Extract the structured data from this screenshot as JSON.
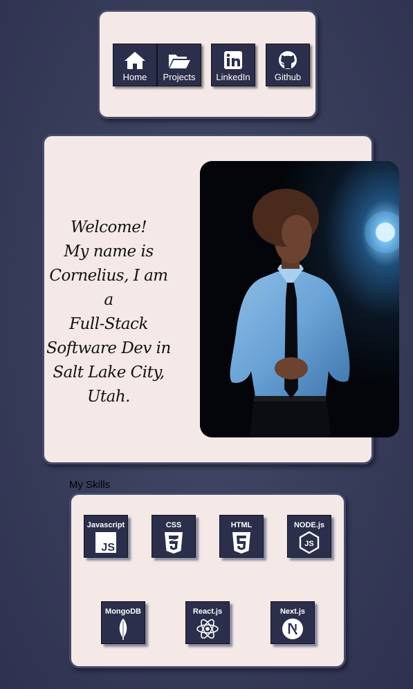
{
  "nav": {
    "items": [
      {
        "label": "Home",
        "icon": "home-icon"
      },
      {
        "label": "Projects",
        "icon": "folder-open-icon"
      },
      {
        "label": "LinkedIn",
        "icon": "linkedin-icon"
      },
      {
        "label": "Github",
        "icon": "github-icon"
      }
    ]
  },
  "hero": {
    "welcome_lines": [
      "Welcome!",
      "My name is",
      "Cornelius, I am a",
      "Full-Stack",
      "Software Dev in",
      "Salt Lake City,",
      "Utah."
    ],
    "photo": "portrait-photo"
  },
  "skills": {
    "title": "My Skills",
    "items": [
      {
        "label": "Javascript",
        "icon": "javascript-icon"
      },
      {
        "label": "CSS",
        "icon": "css3-icon"
      },
      {
        "label": "HTML",
        "icon": "html5-icon"
      },
      {
        "label": "NODE.js",
        "icon": "nodejs-icon"
      },
      {
        "label": "MongoDB",
        "icon": "mongodb-icon"
      },
      {
        "label": "React.js",
        "icon": "react-icon"
      },
      {
        "label": "Next.js",
        "icon": "nextjs-icon"
      }
    ]
  },
  "colors": {
    "background": "#3a3f5c",
    "card": "#f4e9e6",
    "card_border": "#454b6b",
    "button": "#2b2f4b"
  }
}
